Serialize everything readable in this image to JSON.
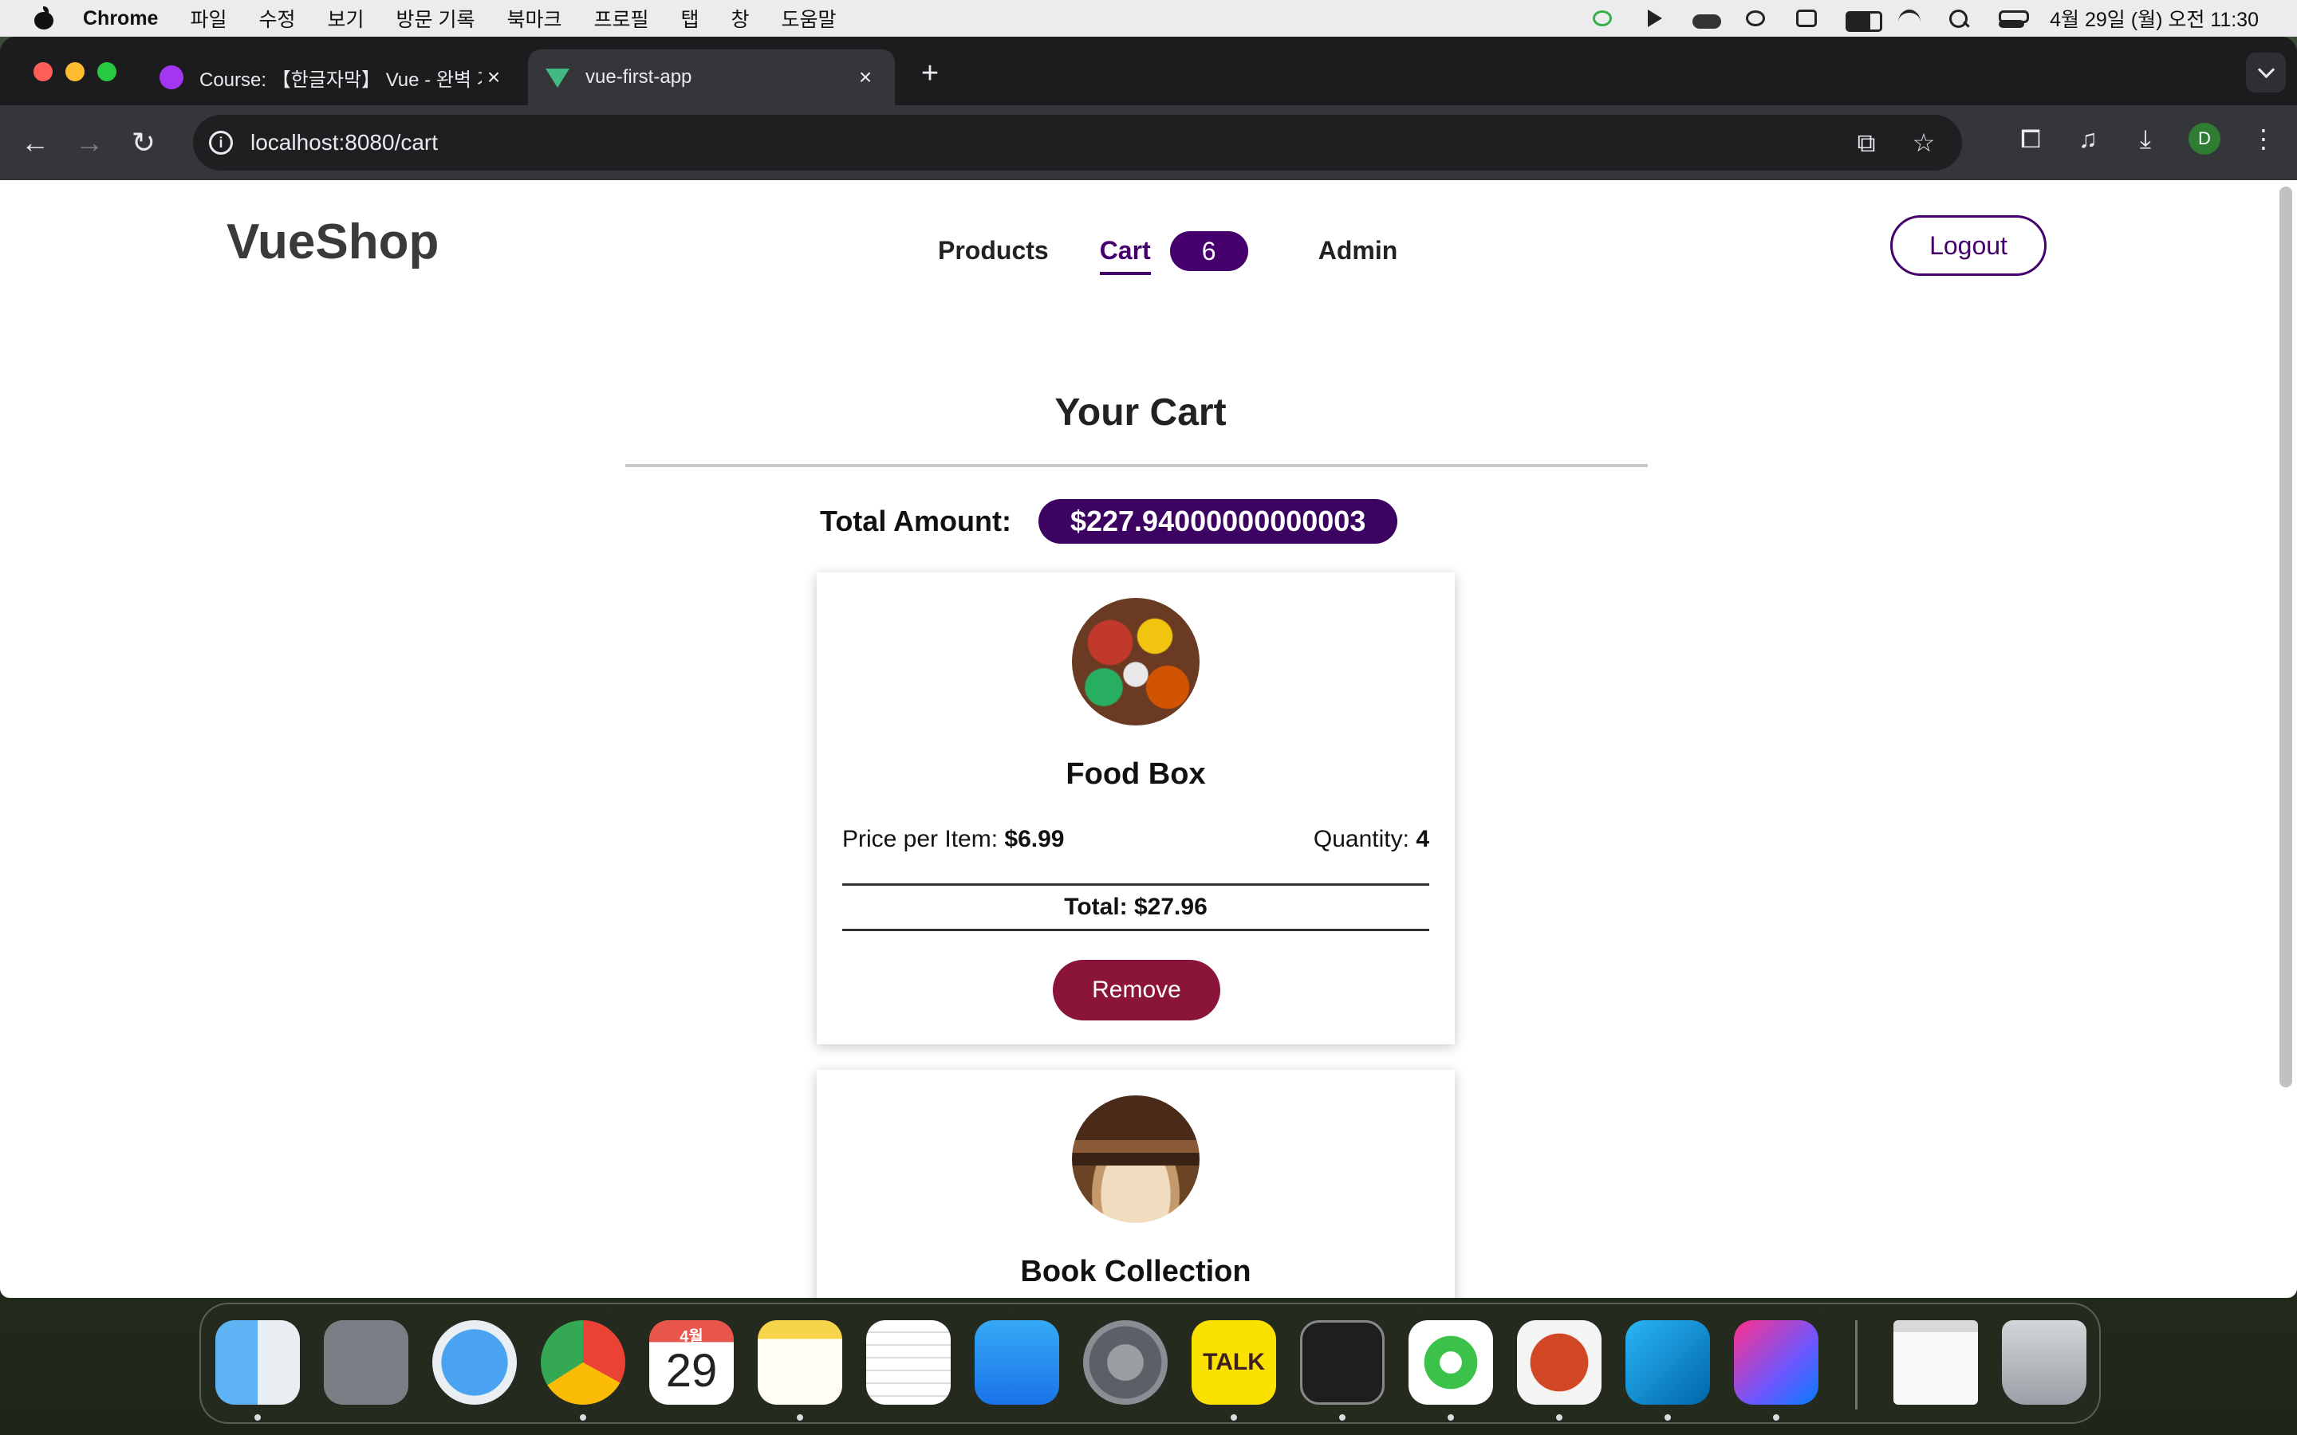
{
  "menubar": {
    "app_name": "Chrome",
    "items": [
      "파일",
      "수정",
      "보기",
      "방문 기록",
      "북마크",
      "프로필",
      "탭",
      "창",
      "도움말"
    ],
    "clock": "4월 29일 (월) 오전 11:30"
  },
  "browser": {
    "tabs": [
      {
        "title": "Course: 【한글자막】 Vue - 완벽 가이드",
        "active": false
      },
      {
        "title": "vue-first-app",
        "active": true
      }
    ],
    "url": "localhost:8080/cart",
    "profile_initial": "D"
  },
  "app": {
    "logo": "VueShop",
    "nav": {
      "products": "Products",
      "cart": "Cart",
      "cart_count": "6",
      "admin": "Admin"
    },
    "logout": "Logout",
    "page_title": "Your Cart",
    "total_label": "Total Amount:",
    "total_value": "$227.94000000000003",
    "items": [
      {
        "name": "Food Box",
        "price_label": "Price per Item:",
        "price": "$6.99",
        "qty_label": "Quantity:",
        "qty": "4",
        "total": "Total: $27.96",
        "remove": "Remove"
      },
      {
        "name": "Book Collection"
      }
    ]
  },
  "dock": {
    "calendar_month": "4월",
    "calendar_day": "29",
    "talk": "TALK",
    "apps": [
      "Finder",
      "Launchpad",
      "Safari",
      "Chrome",
      "Calendar",
      "Notes",
      "TextEdit",
      "App Store",
      "System Settings",
      "KakaoTalk",
      "Terminal",
      "Mirror",
      "PowerPoint",
      "VS Code",
      "IntelliJ IDEA",
      "Preview",
      "Trash"
    ]
  },
  "colors": {
    "brand": "#45006d",
    "total_badge": "#3c0363",
    "remove_button": "#8a1538"
  }
}
